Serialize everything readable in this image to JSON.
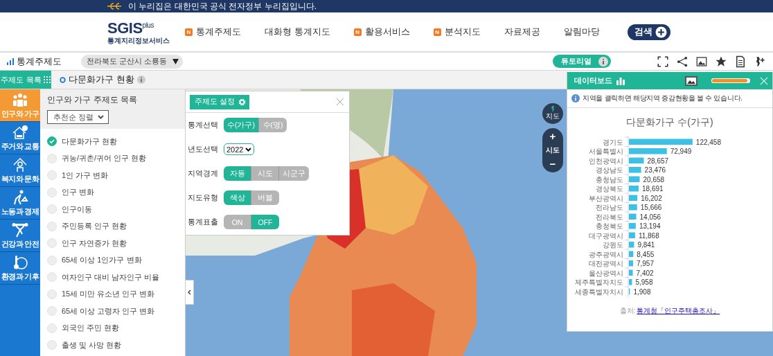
{
  "gov_banner": {
    "text": "이 누리집은 대한민국 공식 전자정부 누리집입니다."
  },
  "header": {
    "logo": {
      "name": "SGIS",
      "sup": "plus",
      "subtitle": "통계지리정보서비스"
    },
    "nav": [
      {
        "label": "통계주제도",
        "badge": "N"
      },
      {
        "label": "대화형 통계지도"
      },
      {
        "label": "활용서비스",
        "badge": "N"
      },
      {
        "label": "분석지도",
        "badge": "N"
      },
      {
        "label": "자료제공"
      },
      {
        "label": "알림마당"
      }
    ],
    "search_button": "검색"
  },
  "toolbar": {
    "title": "통계주제도",
    "region": "전라북도 군산시 소룡동",
    "tutorial": "튜토리얼"
  },
  "theme_bar": {
    "list_button": "주제도 목록",
    "current": "다문화가구 현황"
  },
  "categories": [
    {
      "label": "인구와 가구",
      "selected": true
    },
    {
      "label": "주거와 교통",
      "selected": false
    },
    {
      "label": "복지와 문화",
      "selected": false
    },
    {
      "label": "노동과 경제",
      "selected": false
    },
    {
      "label": "건강과 안전",
      "selected": false
    },
    {
      "label": "환경과 기후",
      "selected": false
    }
  ],
  "theme_list": {
    "title": "인구와 가구 주제도 목록",
    "sort": "추천순 정렬",
    "items": [
      {
        "label": "다문화가구 현황",
        "selected": true
      },
      {
        "label": "귀농/귀촌/귀어 인구 현황",
        "selected": false
      },
      {
        "label": "1인 가구 변화",
        "selected": false
      },
      {
        "label": "인구 변화",
        "selected": false
      },
      {
        "label": "인구이동",
        "selected": false
      },
      {
        "label": "주민등록 인구 현황",
        "selected": false
      },
      {
        "label": "인구 자연증가 현황",
        "selected": false
      },
      {
        "label": "65세 이상 1인가구 변화",
        "selected": false
      },
      {
        "label": "여자인구 대비 남자인구 비율",
        "selected": false
      },
      {
        "label": "15세 미만 유소년 인구 변화",
        "selected": false
      },
      {
        "label": "65세 이상 고령자 인구 변화",
        "selected": false
      },
      {
        "label": "외국인 주민 현황",
        "selected": false
      },
      {
        "label": "출생 및 사망 현황",
        "selected": false
      }
    ]
  },
  "settings": {
    "title": "주제도 설정",
    "rows": [
      {
        "label": "통계선택",
        "kind": "toggle",
        "options": [
          {
            "label": "수(가구)",
            "selected": true
          },
          {
            "label": "수(명)",
            "selected": false
          }
        ]
      },
      {
        "label": "년도선택",
        "kind": "select",
        "value": "2022"
      },
      {
        "label": "지역경계",
        "kind": "toggle",
        "options": [
          {
            "label": "자동",
            "selected": true
          },
          {
            "label": "시도",
            "selected": false
          },
          {
            "label": "시군구",
            "selected": false
          }
        ]
      },
      {
        "label": "지도유형",
        "kind": "toggle",
        "options": [
          {
            "label": "색상",
            "selected": true
          },
          {
            "label": "버블",
            "selected": false
          }
        ]
      },
      {
        "label": "통계표출",
        "kind": "toggle",
        "options": [
          {
            "label": "ON",
            "selected": false
          },
          {
            "label": "OFF",
            "selected": true
          }
        ]
      }
    ]
  },
  "map_controls": {
    "map_button": "지도",
    "zoom_in": "+",
    "level": "시도",
    "zoom_out": "−"
  },
  "dashboard": {
    "title": "데이터보드",
    "opacity": {
      "level": 0.95
    },
    "notice": "지역을 클릭하면 해당지역 증감현황을 볼 수 있습니다.",
    "chart_data": {
      "type": "bar",
      "orientation": "horizontal",
      "title": "다문화가구 수(가구)",
      "categories": [
        "경기도",
        "서울특별시",
        "인천광역시",
        "경상남도",
        "충청남도",
        "경상북도",
        "부산광역시",
        "전라남도",
        "전라북도",
        "충청북도",
        "대구광역시",
        "강원도",
        "광주광역시",
        "대전광역시",
        "울산광역시",
        "제주특별자치도",
        "세종특별자치시"
      ],
      "series": [
        {
          "color": "#3dbfe6",
          "values": [
            122458,
            72949,
            28657,
            23476,
            20658,
            18691,
            16202,
            15666,
            14056,
            13194,
            11868,
            9841,
            8455,
            7957,
            7402,
            5958,
            1908
          ],
          "value_labels": [
            "122,458",
            "72,949",
            "28,657",
            "23,476",
            "20,658",
            "18,691",
            "16,202",
            "15,666",
            "14,056",
            "13,194",
            "11,868",
            "9,841",
            "8,455",
            "7,957",
            "7,402",
            "5,958",
            "1,908"
          ]
        }
      ]
    },
    "source": {
      "prefix": "출처:",
      "link": "통계청「인구주택총조사」"
    }
  }
}
